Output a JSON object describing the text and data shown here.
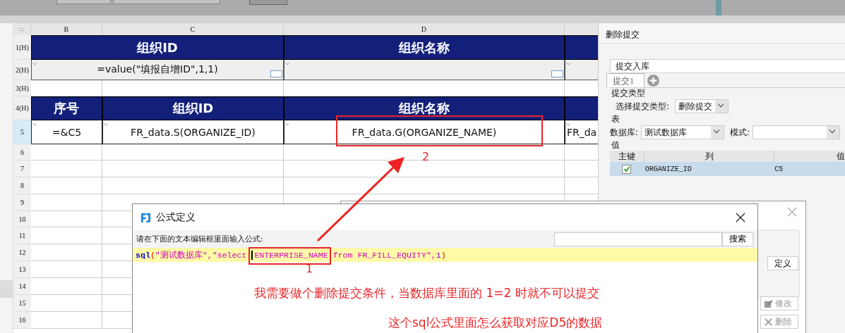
{
  "sheet": {
    "columns": [
      "B",
      "C",
      "D",
      ""
    ],
    "rows": [
      {
        "label": "1(H)",
        "selected": false,
        "cells": [
          {
            "kind": "header",
            "merged": true,
            "text": "组织ID"
          },
          {
            "kind": "header",
            "text": "组织名称"
          },
          {
            "kind": "header"
          }
        ]
      },
      {
        "label": "2(H)",
        "selected": false,
        "cells": [
          {
            "kind": "gray",
            "merged": true,
            "text": "=value(\"填报自增ID\",1,1)"
          },
          {
            "kind": "gray"
          },
          {
            "kind": "gray"
          }
        ]
      },
      {
        "label": "3(H)",
        "selected": false
      },
      {
        "label": "4(H)",
        "selected": false,
        "cells": [
          {
            "kind": "header",
            "text": "序号"
          },
          {
            "kind": "header",
            "text": "组织ID"
          },
          {
            "kind": "header",
            "text": "组织名称"
          },
          {
            "kind": "header"
          }
        ]
      },
      {
        "label": "5",
        "selected": true,
        "cells": [
          {
            "kind": "bordered",
            "text": "=&C5"
          },
          {
            "kind": "bordered",
            "text": "FR_data.S(ORGANIZE_ID)"
          },
          {
            "kind": "bordered",
            "text": "FR_data.G(ORGANIZE_NAME)"
          },
          {
            "kind": "bordered",
            "text": "FR_da"
          }
        ]
      },
      {
        "label": "6",
        "selected": false
      },
      {
        "label": "7",
        "selected": false
      },
      {
        "label": "8",
        "selected": false
      },
      {
        "label": "9",
        "selected": false
      },
      {
        "label": "10",
        "selected": false
      },
      {
        "label": "11",
        "selected": false
      },
      {
        "label": "12",
        "selected": false
      },
      {
        "label": "13",
        "selected": false
      },
      {
        "label": "14",
        "selected": false
      },
      {
        "label": "15",
        "selected": false
      },
      {
        "label": "16",
        "selected": false
      }
    ]
  },
  "panel": {
    "title": "删除提交",
    "name_field": "提交入库",
    "tabs": [
      {
        "label": "提交1",
        "selected": true
      }
    ],
    "section_type": "提交类型",
    "type_label": "选择提交类型:",
    "type_value": "删除提交",
    "section_table": "表",
    "db_label": "数据库:",
    "db_value": "测试数据库",
    "mode_label": "模式:",
    "section_value": "值",
    "table": {
      "columns": [
        "主键",
        "列",
        "值"
      ],
      "rows": [
        {
          "checked": true,
          "column": "ORGANIZE_ID",
          "value": "C5",
          "selected": true
        }
      ]
    }
  },
  "back_dialog": {
    "buttons": [
      {
        "label": "定义",
        "disabled": false
      },
      {
        "label": "修改",
        "disabled": true
      },
      {
        "label": "删除",
        "disabled": true
      }
    ]
  },
  "formula_dialog": {
    "title": "公式定义",
    "prompt": "请在下面的文本编辑框里面输入公式:",
    "search_button": "搜索",
    "tokens": [
      {
        "kind": "function",
        "text": "sql"
      },
      {
        "kind": "paren",
        "text": "("
      },
      {
        "kind": "string",
        "text": "\"测试数据库\",\"select "
      },
      {
        "kind": "cursor"
      },
      {
        "kind": "string",
        "text": "ENTERPRISE_NAME"
      },
      {
        "kind": "string",
        "text": " from FR_FILL_EQUITY\""
      },
      {
        "kind": "punct",
        "text": ","
      },
      {
        "kind": "number",
        "text": "1"
      },
      {
        "kind": "paren",
        "text": ")"
      }
    ]
  },
  "annotations": {
    "label_1": "1",
    "label_2": "2",
    "notes": [
      "我需要做个删除提交条件，当数据库里面的 1=2 时就不可以提交",
      "这个sql公式里面怎么获取对应D5的数据"
    ]
  }
}
